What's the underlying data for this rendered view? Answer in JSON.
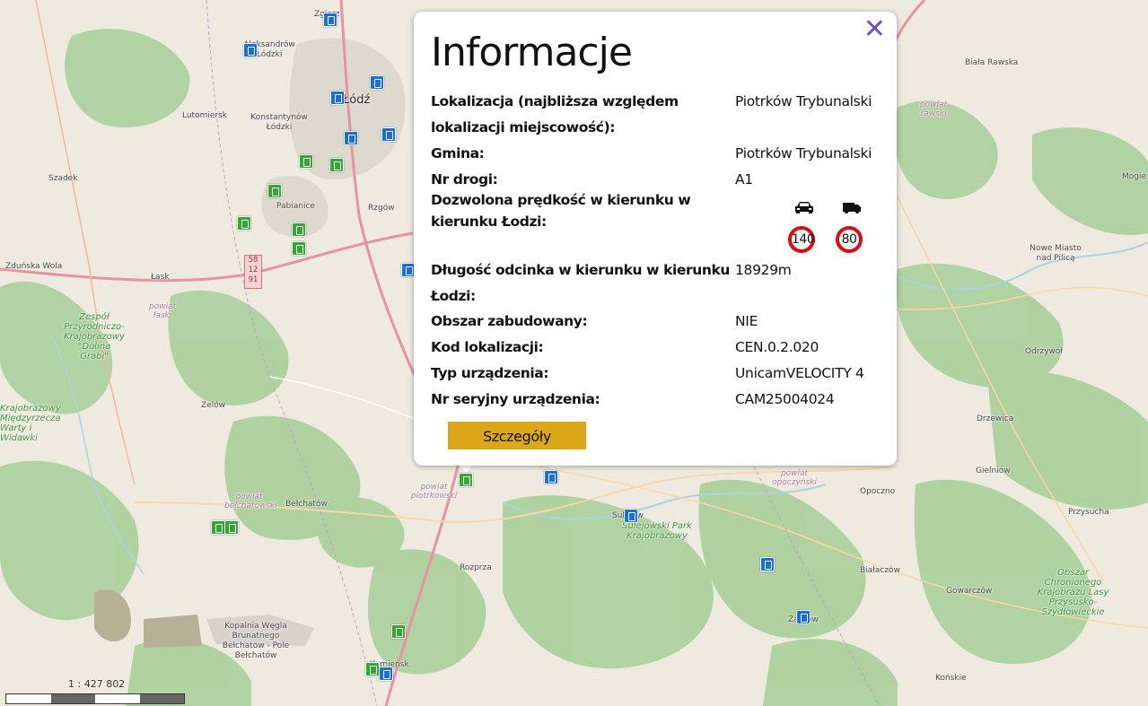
{
  "popup": {
    "title": "Informacje",
    "close_icon": "close-icon",
    "fields": [
      {
        "label": "Lokalizacja (najbliższa względem lokalizacji miejscowość):",
        "value": "Piotrków Trybunalski"
      },
      {
        "label": "Gmina:",
        "value": "Piotrków Trybunalski"
      },
      {
        "label": "Nr drogi:",
        "value": "A1"
      },
      {
        "label": "Dozwolona prędkość w kierunku w kierunku Łodzi:",
        "value": ""
      },
      {
        "label": "Długość odcinka w kierunku w kierunku Łodzi:",
        "value": "18929m"
      },
      {
        "label": "Obszar zabudowany:",
        "value": "NIE"
      },
      {
        "label": "Kod lokalizacji:",
        "value": "CEN.0.2.020"
      },
      {
        "label": "Typ urządzenia:",
        "value": "UnicamVELOCITY 4"
      },
      {
        "label": "Nr seryjny urządzenia:",
        "value": "CAM25004024"
      }
    ],
    "speed_limits": {
      "car": {
        "icon": "car-icon",
        "value": "140"
      },
      "truck": {
        "icon": "truck-icon",
        "value": "80"
      }
    },
    "details_button": "Szczegóły"
  },
  "map": {
    "scale_text": "1 : 427 802",
    "road_shield": [
      "58",
      "12",
      "91"
    ],
    "places": [
      {
        "name": "Łódź",
        "cls": "big"
      },
      {
        "name": "Aleksandrów Łódzki"
      },
      {
        "name": "Lutomiersk"
      },
      {
        "name": "Konstantynów Łódzki"
      },
      {
        "name": "Szadek"
      },
      {
        "name": "Pabianice"
      },
      {
        "name": "Rzgów"
      },
      {
        "name": "Zduńska Wola"
      },
      {
        "name": "Łask"
      },
      {
        "name": "Zelów"
      },
      {
        "name": "Bełchatów"
      },
      {
        "name": "Rozprza"
      },
      {
        "name": "Opoczno"
      },
      {
        "name": "Przysucha"
      },
      {
        "name": "Drzewica"
      },
      {
        "name": "Gielniów"
      },
      {
        "name": "Odrzywół"
      },
      {
        "name": "Nowe Miasto nad Pilicą"
      },
      {
        "name": "Biała Rawska"
      },
      {
        "name": "Białaczów"
      },
      {
        "name": "Gowarczów"
      },
      {
        "name": "Końskie"
      },
      {
        "name": "Sulejowski Park Krajobrazowy",
        "cls": "green"
      },
      {
        "name": "Obszar Chronionego Krajobrazu Lasy Przysusko-Szydłowieckie",
        "cls": "green"
      },
      {
        "name": "Zespół Przyrodniczo-Krajobrazowy \"Dolina Grabi\"",
        "cls": "green"
      },
      {
        "name": "Kopalnia Węgla Brunatnego Bełchatów - Pole Bełchatów"
      },
      {
        "name": "powiat piotrkowski",
        "cls": "pink"
      },
      {
        "name": "powiat bełchatowski",
        "cls": "pink"
      },
      {
        "name": "powiat opoczyński",
        "cls": "pink"
      },
      {
        "name": "powiat rawski",
        "cls": "pink"
      },
      {
        "name": "powiat łaski",
        "cls": "pink"
      },
      {
        "name": "Krajobrazowy Międzyrzecza Warty i Widawki",
        "cls": "green"
      },
      {
        "name": "Mogie"
      },
      {
        "name": "Sulejów"
      },
      {
        "name": "Żarnów"
      },
      {
        "name": "Kamieńsk"
      },
      {
        "name": "Zgierz"
      }
    ]
  },
  "colors": {
    "accent_button": "#dba81c",
    "close_icon": "#6a52c2",
    "sign_border": "#d41010",
    "marker_blue": "#1a6fd0",
    "marker_green": "#35a635"
  }
}
